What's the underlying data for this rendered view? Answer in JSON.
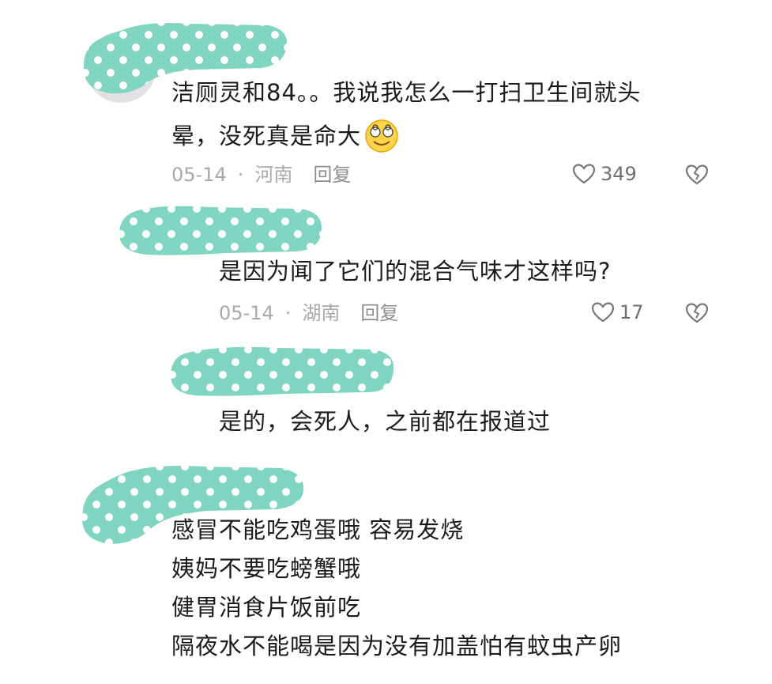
{
  "comments": [
    {
      "text_lines": [
        "洁厕灵和84。。我说我怎么一打扫卫生间就头",
        "晕，没死真是命大"
      ],
      "emoji": "dizzy-face",
      "date": "05-14",
      "dot": "·",
      "location": "河南",
      "reply_label": "回复",
      "like_count": "349"
    },
    {
      "text_lines": [
        "是因为闻了它们的混合气味才这样吗?"
      ],
      "date": "05-14",
      "dot": "·",
      "location": "湖南",
      "reply_label": "回复",
      "like_count": "17"
    },
    {
      "text_lines": [
        "是的，会死人，之前都在报道过"
      ]
    },
    {
      "text_lines": [
        "感冒不能吃鸡蛋哦 容易发烧",
        "姨妈不要吃螃蟹哦",
        "健胃消食片饭前吃",
        "隔夜水不能喝是因为没有加盖怕有蚊虫产卵"
      ]
    }
  ],
  "colors": {
    "redaction": "#80d5c0",
    "dots": "#ffffff",
    "text": "#1b1b1b",
    "meta": "#a9a9a9"
  },
  "icons": [
    "heart-outline-icon",
    "dislike-broken-heart-icon",
    "dizzy-face-emoji-icon"
  ]
}
